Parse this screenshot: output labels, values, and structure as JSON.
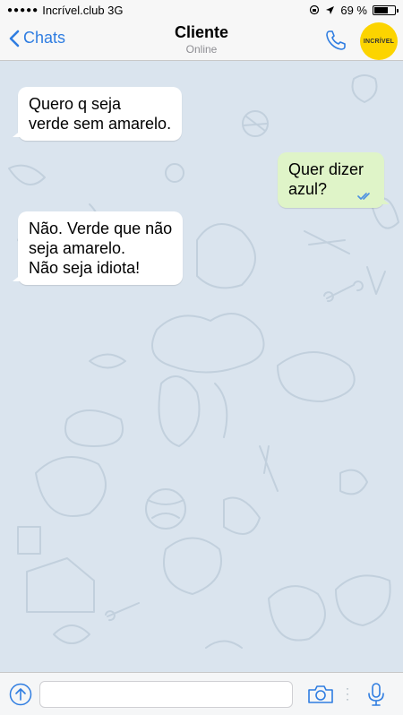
{
  "status_bar": {
    "signal": "●●●●●",
    "carrier": "Incrível.club 3G",
    "battery_text": "69 %",
    "battery_level": 0.69
  },
  "header": {
    "back_label": "Chats",
    "contact_name": "Cliente",
    "contact_status": "Online",
    "avatar_text": "INCRÍVEL"
  },
  "messages": [
    {
      "direction": "in",
      "lines": [
        "Quero q seja",
        "verde sem amarelo."
      ]
    },
    {
      "direction": "out",
      "lines": [
        "Quer dizer",
        "azul?"
      ],
      "read": true
    },
    {
      "direction": "in",
      "lines": [
        "Não. Verde que não",
        "seja amarelo.",
        "Não seja idiota!"
      ]
    }
  ],
  "input": {
    "placeholder": ""
  },
  "colors": {
    "accent": "#2f7de1",
    "chat_background": "#dae4ee",
    "incoming_bubble": "#ffffff",
    "outgoing_bubble": "#dff4c8",
    "avatar": "#fcd400"
  }
}
